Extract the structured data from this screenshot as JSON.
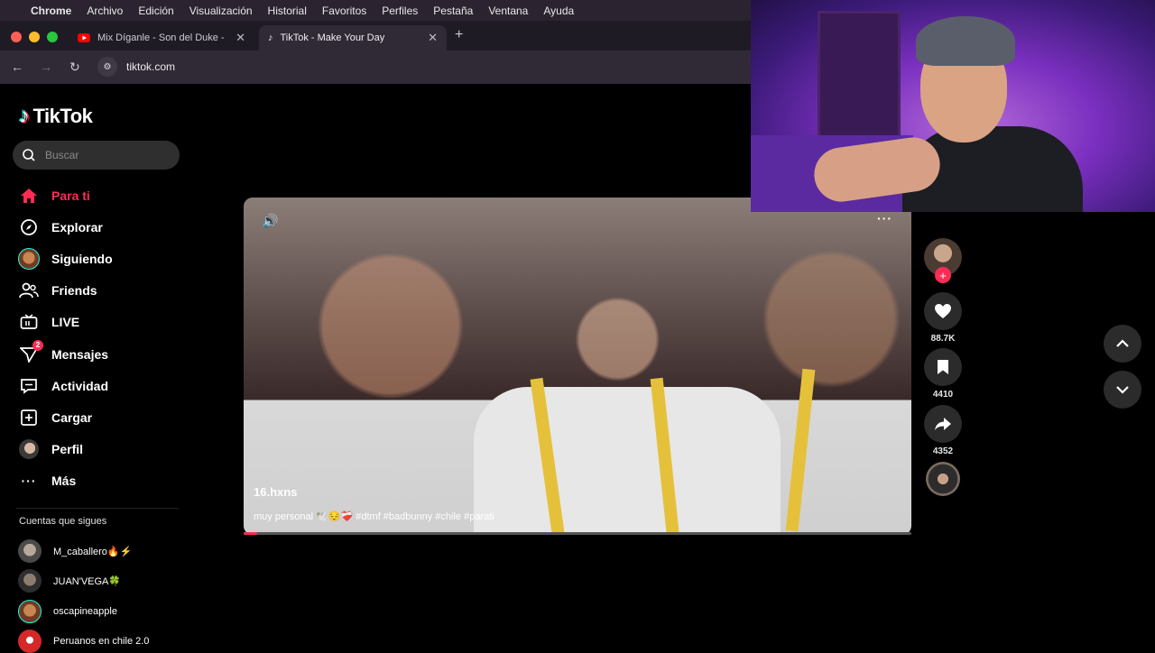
{
  "menubar": {
    "app": "Chrome",
    "items": [
      "Archivo",
      "Edición",
      "Visualización",
      "Historial",
      "Favoritos",
      "Perfiles",
      "Pestaña",
      "Ventana",
      "Ayuda"
    ]
  },
  "tabs": [
    {
      "label": "Mix Díganle - Son del Duke -",
      "icon": "youtube-icon",
      "active": false
    },
    {
      "label": "TikTok - Make Your Day",
      "icon": "tiktok-icon",
      "active": true
    }
  ],
  "address": {
    "url": "tiktok.com"
  },
  "sidebar": {
    "logo_text": "TikTok",
    "search_placeholder": "Buscar",
    "nav": [
      {
        "label": "Para ti",
        "icon": "home-icon",
        "active": true
      },
      {
        "label": "Explorar",
        "icon": "compass-icon"
      },
      {
        "label": "Siguiendo",
        "icon": "avatar-icon"
      },
      {
        "label": "Friends",
        "icon": "friends-icon"
      },
      {
        "label": "LIVE",
        "icon": "live-tv-icon"
      },
      {
        "label": "Mensajes",
        "icon": "send-icon",
        "badge": "2"
      },
      {
        "label": "Actividad",
        "icon": "activity-icon"
      },
      {
        "label": "Cargar",
        "icon": "upload-icon"
      },
      {
        "label": "Perfil",
        "icon": "profile-icon"
      },
      {
        "label": "Más",
        "icon": "more-icon"
      }
    ],
    "following_title": "Cuentas que sigues",
    "following": [
      {
        "name": "M_caballero🔥⚡"
      },
      {
        "name": "JUAN'VEGA🍀"
      },
      {
        "name": "oscapineapple"
      },
      {
        "name": "Peruanos en chile 2.0"
      }
    ]
  },
  "video": {
    "author": "16.hxns",
    "caption": "muy personal 🕊️😔❤️‍🩹 #dtmf #badbunny #chile #parati",
    "progress": 0.02
  },
  "actions": {
    "likes": "88.7K",
    "saves": "4410",
    "shares": "4352"
  },
  "colors": {
    "accent": "#fe2c55",
    "menubar": "#2b2430",
    "tabbar": "#1f1b24"
  }
}
